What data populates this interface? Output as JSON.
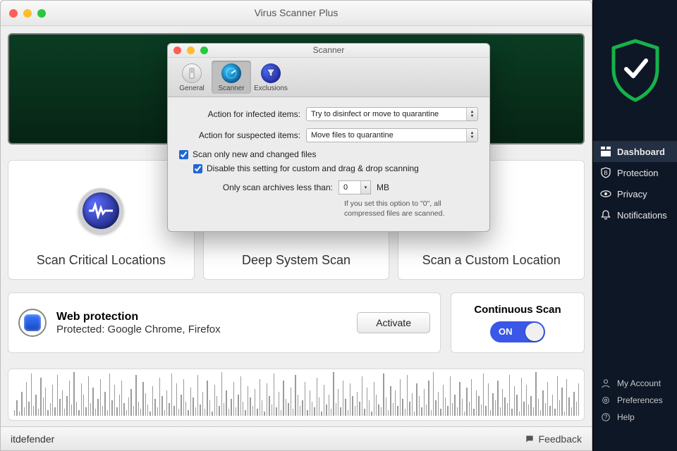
{
  "main_window": {
    "title": "Virus Scanner Plus",
    "scan_cards": [
      {
        "label": "Scan Critical Locations"
      },
      {
        "label": "Deep System Scan"
      },
      {
        "label": "Scan a Custom Location"
      }
    ],
    "web_protection": {
      "title": "Web protection",
      "subtitle": "Protected: Google Chrome, Firefox",
      "button": "Activate"
    },
    "continuous_scan": {
      "title": "Continuous Scan",
      "state_label": "ON"
    },
    "footer_brand": "itdefender",
    "footer_feedback": "Feedback"
  },
  "sidebar": {
    "nav": [
      {
        "label": "Dashboard",
        "icon": "dashboard-icon",
        "active": true
      },
      {
        "label": "Protection",
        "icon": "shield-b-icon",
        "active": false
      },
      {
        "label": "Privacy",
        "icon": "eye-icon",
        "active": false
      },
      {
        "label": "Notifications",
        "icon": "bell-icon",
        "active": false
      }
    ],
    "bottom": [
      {
        "label": "My Account",
        "icon": "user-icon"
      },
      {
        "label": "Preferences",
        "icon": "gear-icon"
      },
      {
        "label": "Help",
        "icon": "help-icon"
      }
    ]
  },
  "modal": {
    "title": "Scanner",
    "tabs": [
      {
        "label": "General"
      },
      {
        "label": "Scanner"
      },
      {
        "label": "Exclusions"
      }
    ],
    "infected_label": "Action for infected items:",
    "infected_value": "Try to disinfect or move to quarantine",
    "suspected_label": "Action for suspected items:",
    "suspected_value": "Move files to quarantine",
    "chk_scan_new": "Scan only new and changed files",
    "chk_disable_custom": "Disable this setting for custom and drag & drop scanning",
    "archives_label": "Only scan archives less than:",
    "archives_value": "0",
    "archives_unit": "MB",
    "archives_hint": "If you set this option to \"0\", all compressed files are scanned."
  }
}
